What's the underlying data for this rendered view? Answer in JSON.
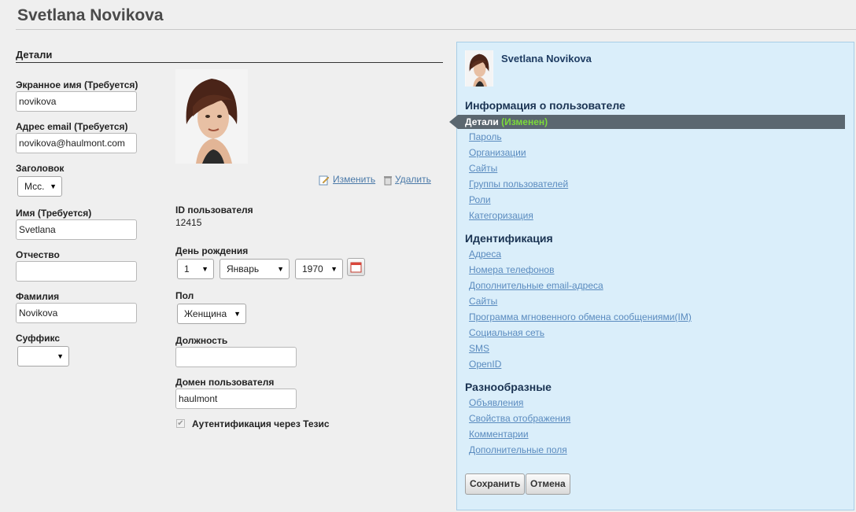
{
  "header": {
    "title": "Svetlana Novikova"
  },
  "form": {
    "section_title": "Детали",
    "screen_name": {
      "label": "Экранное имя (Требуется)",
      "value": "novikova"
    },
    "email": {
      "label": "Адрес email (Требуется)",
      "value": "novikova@haulmont.com"
    },
    "prefix": {
      "label": "Заголовок",
      "value": "Мсс."
    },
    "first_name": {
      "label": "Имя (Требуется)",
      "value": "Svetlana"
    },
    "middle_name": {
      "label": "Отчество",
      "value": ""
    },
    "last_name": {
      "label": "Фамилия",
      "value": "Novikova"
    },
    "suffix": {
      "label": "Суффикс",
      "value": ""
    },
    "photo": {
      "change_label": "Изменить",
      "delete_label": "Удалить"
    },
    "user_id": {
      "label": "ID пользователя",
      "value": "12415"
    },
    "birthday": {
      "label": "День рождения",
      "day": "1",
      "month": "Январь",
      "year": "1970"
    },
    "gender": {
      "label": "Пол",
      "value": "Женщина"
    },
    "job_title": {
      "label": "Должность",
      "value": ""
    },
    "domain": {
      "label": "Домен пользователя",
      "value": "haulmont"
    },
    "tezis_auth": {
      "label": "Аутентификация через Тезис",
      "checked": true
    }
  },
  "panel": {
    "user_name": "Svetlana Novikova",
    "user_info_heading": "Информация о пользователе",
    "active_item": "Детали",
    "active_changed": "(Изменен)",
    "user_info_items": [
      "Пароль",
      "Организации",
      "Сайты",
      "Группы пользователей",
      "Роли",
      "Категоризация"
    ],
    "identification_heading": "Идентификация",
    "identification_items": [
      "Адреса",
      "Номера телефонов",
      "Дополнительные email-адреса",
      "Сайты",
      "Программа мгновенного обмена сообщениями(IM)",
      "Социальная сеть",
      "SMS",
      "OpenID"
    ],
    "misc_heading": "Разнообразные",
    "misc_items": [
      "Объявления",
      "Свойства отображения",
      "Комментарии",
      "Дополнительные поля"
    ],
    "save_label": "Сохранить",
    "cancel_label": "Отмена"
  }
}
